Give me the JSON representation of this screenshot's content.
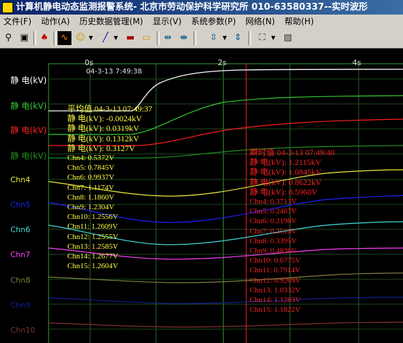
{
  "window": {
    "title": "计算机静电动态监测报警系统- 北京市劳动保护科学研究所 010-63580337--实时波形"
  },
  "menu": {
    "items": [
      "文件(F)",
      "动作(A)",
      "历史数据管理(M)",
      "显示(V)",
      "系统参数(P)",
      "网络(N)",
      "帮助(H)"
    ]
  },
  "toolbar": {
    "icons": [
      "binoculars-icon",
      "monitor-icon",
      "bell-icon",
      "scope-icon",
      "smiley-icon",
      "pen-icon",
      "erase-icon",
      "folder-icon",
      "expand-h-icon",
      "compress-h-icon",
      "expand-v-icon",
      "compress-v-icon",
      "zoom-icon",
      "fit-icon"
    ],
    "glyphs": [
      "⚲",
      "▣",
      "♠",
      "∿",
      "☺",
      "╱",
      "▬",
      "▭",
      "⇹",
      "⇼",
      "⇳",
      "⇕",
      "⛶",
      "▨"
    ]
  },
  "plot": {
    "time_ticks": [
      "0s",
      "2s",
      "4s"
    ],
    "cursor_time": "04-3-13 7:49:38",
    "channels": [
      {
        "label": "静 电(kV)",
        "color": "#ffffff"
      },
      {
        "label": "静 电(kV)",
        "color": "#33cc33"
      },
      {
        "label": "静 电(kV)",
        "color": "#ff2020"
      },
      {
        "label": "静 电(kV)",
        "color": "#209020"
      },
      {
        "label": "Chn4",
        "color": "#f0f040"
      },
      {
        "label": "Chn5",
        "color": "#2020ff"
      },
      {
        "label": "Chn6",
        "color": "#40e0e0"
      },
      {
        "label": "Chn7",
        "color": "#ff40ff"
      },
      {
        "label": "Chn8",
        "color": "#808040"
      },
      {
        "label": "Chn9",
        "color": "#102090"
      },
      {
        "label": "Chn10",
        "color": "#803030"
      }
    ]
  },
  "average_panel": {
    "header": "平均值 04-3-13 07:49:37",
    "color": "#ffff40",
    "rows": [
      "静 电(kV): -0.0024kV",
      "静 电(kV): 0.0319kV",
      "静 电(kV): 0.1312kV",
      "静 电(kV): 0.3127V",
      "Chn4: 0.5372V",
      "Chn5: 0.7845V",
      "Chn6: 0.9937V",
      "Chn7: 1.1174V",
      "Chn8: 1.1860V",
      "Chn9: 1.2304V",
      "Chn10: 1.2556V",
      "Chn11: 1.2609V",
      "Chn12: 1.2555V",
      "Chn13: 1.2585V",
      "Chn14: 1.2677V",
      "Chn15: 1.2604V"
    ]
  },
  "instant_panel": {
    "header": "瞬时值 04-3-13 07:49:40",
    "color": "#ff2020",
    "rows": [
      "静 电(kV): 1.2115kV",
      "静 电(kV): 1.0845kV",
      "静 电(kV): 0.8622kV",
      "静 电(kV): 0.5960V",
      "Chn4: 0.3713V",
      "Chn5: 0.2467V",
      "Chn6: 0.2198V",
      "Chn7: 0.2516V",
      "Chn8: 0.3395V",
      "Chn9: 0.4836V",
      "Chn10: 0.6775V",
      "Chn11: 0.7914V",
      "Chn12: 0.9209V",
      "Chn13: 1.0332V",
      "Chn14: 1.1283V",
      "Chn15: 1.1822V"
    ]
  }
}
